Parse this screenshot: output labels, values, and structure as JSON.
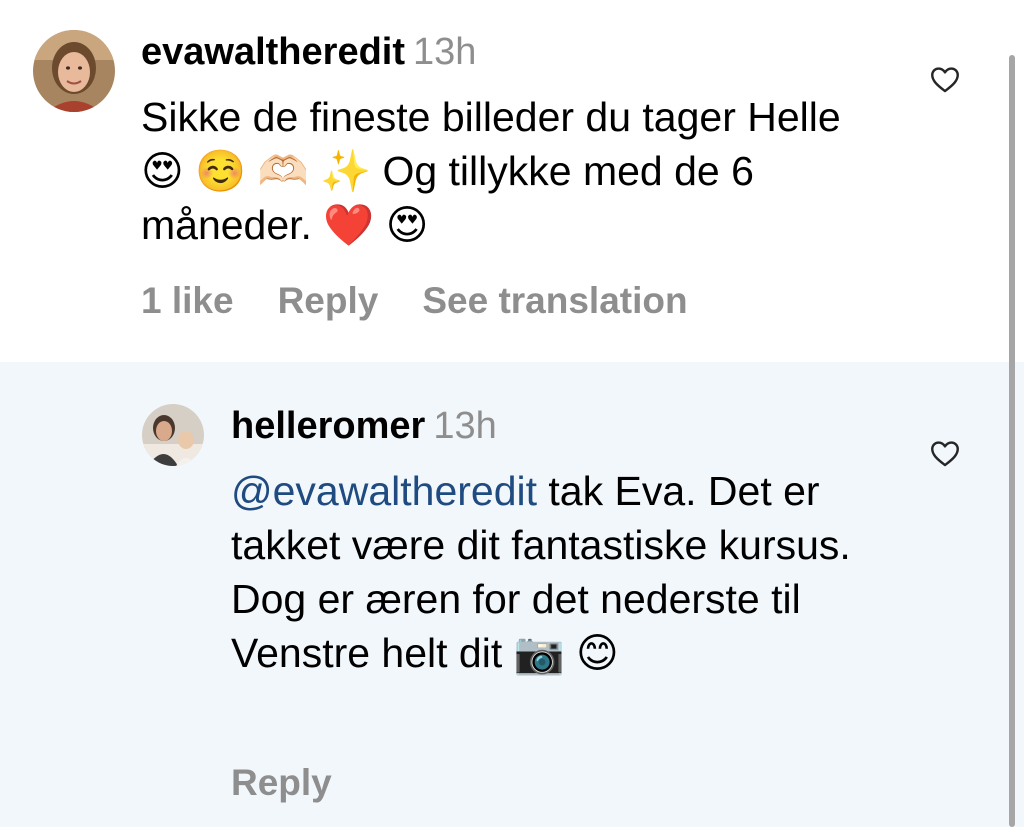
{
  "comments": [
    {
      "username": "evawaltheredit",
      "time": "13h",
      "text_before": "Sikke de fineste billeder du tager Helle 😍 ☺️ 🫶🏻 ✨ Og tillykke med de 6 måneder. ❤️ 😍",
      "likes_label": "1 like",
      "reply_label": "Reply",
      "translation_label": "See translation",
      "avatar_icon": "avatar-woman-portrait"
    },
    {
      "username": "helleromer",
      "time": "13h",
      "mention": "@evawaltheredit",
      "text_after": " tak Eva. Det er takket være dit fantastiske kursus. Dog er æren for det nederste til Venstre helt dit 📷 😊",
      "reply_label": "Reply",
      "avatar_icon": "avatar-woman-with-child"
    }
  ],
  "icons": {
    "like": "heart-outline-icon"
  },
  "colors": {
    "reply_background": "#f2f7fc",
    "mention": "#1f4b80",
    "muted_text": "#8e8e8e"
  }
}
